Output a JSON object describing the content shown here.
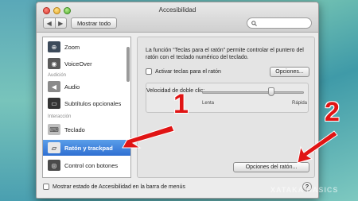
{
  "window": {
    "title": "Accesibilidad",
    "show_all_label": "Mostrar todo",
    "nav_back": "◀",
    "nav_forward": "▶",
    "search": {
      "value": "",
      "placeholder": ""
    }
  },
  "sidebar": {
    "items": [
      {
        "label": "Zoom",
        "icon": "zoom-icon",
        "glyph": "⊕",
        "color": "#3c4a5a"
      },
      {
        "label": "VoiceOver",
        "icon": "voiceover-icon",
        "glyph": "◉",
        "color": "#5a5a5a"
      },
      {
        "label": "Audio",
        "icon": "speaker-icon",
        "glyph": "◀",
        "color": "#8a8a8a"
      },
      {
        "label": "Subtítulos opcionales",
        "icon": "captions-icon",
        "glyph": "▭",
        "color": "#333"
      },
      {
        "label": "Teclado",
        "icon": "keyboard-icon",
        "glyph": "⌨",
        "color": "#bfbfbf"
      },
      {
        "label": "Ratón y trackpad",
        "icon": "mouse-icon",
        "glyph": "▱",
        "color": "#dcdcdc"
      },
      {
        "label": "Control con botones",
        "icon": "switch-control-icon",
        "glyph": "◎",
        "color": "#4a4a4a"
      }
    ],
    "section_audicion": "Audición",
    "section_interaccion": "Interacción",
    "selected": "Ratón y trackpad"
  },
  "content": {
    "description": "La función “Teclas para el ratón” permite controlar el puntero del ratón con el teclado numérico del teclado.",
    "enable_mouse_keys_label": "Activar teclas para el ratón",
    "enable_mouse_keys_checked": false,
    "options_button": "Opciones...",
    "double_click_speed_label": "Velocidad de doble clic:",
    "slow_label": "Lenta",
    "fast_label": "Rápida",
    "double_click_speed_fraction": 0.68,
    "mouse_options_button": "Opciones del ratón..."
  },
  "footer": {
    "show_in_menu_label": "Mostrar estado de Accesibilidad en la barra de menús",
    "show_in_menu_checked": false,
    "help_label": "?"
  },
  "annotations": {
    "marker_1": "1",
    "marker_2": "2",
    "arrow_color": "#e01414"
  },
  "watermark": "XATAKA BASICS"
}
